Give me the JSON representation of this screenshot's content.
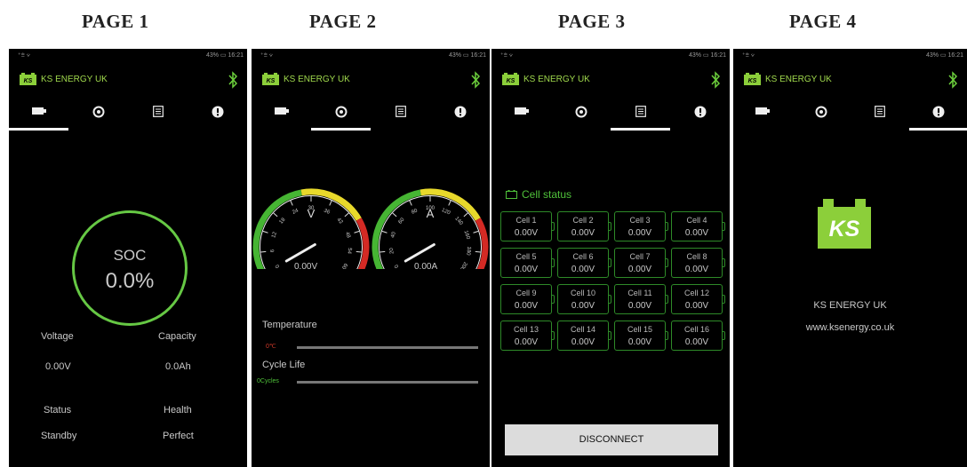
{
  "page_labels": [
    "PAGE 1",
    "PAGE 2",
    "PAGE 3",
    "PAGE 4"
  ],
  "status_bar": {
    "left": "⁺⩧ ⩒",
    "right": "43% ▭ 16:21"
  },
  "app": {
    "title": "KS ENERGY UK",
    "accent": "#66c844",
    "logo_text": "KS"
  },
  "tabs": [
    {
      "name": "battery",
      "icon": "battery-icon"
    },
    {
      "name": "gauges",
      "icon": "gauge-icon"
    },
    {
      "name": "cells",
      "icon": "list-icon"
    },
    {
      "name": "info",
      "icon": "info-icon"
    }
  ],
  "page1": {
    "soc_label": "SOC",
    "soc_value": "0.0%",
    "voltage_label": "Voltage",
    "voltage_value": "0.00V",
    "capacity_label": "Capacity",
    "capacity_value": "0.0Ah",
    "status_label": "Status",
    "status_value": "Standby",
    "health_label": "Health",
    "health_value": "Perfect"
  },
  "page2": {
    "voltage_gauge": {
      "unit": "V",
      "value": "0.00V",
      "ticks": [
        "0",
        "6",
        "12",
        "18",
        "24",
        "30",
        "36",
        "42",
        "48",
        "54",
        "60"
      ]
    },
    "current_gauge": {
      "unit": "A",
      "value": "0.00A",
      "ticks": [
        "0",
        "20",
        "40",
        "60",
        "80",
        "100",
        "120",
        "140",
        "160",
        "180",
        "200"
      ]
    },
    "temperature_label": "Temperature",
    "temperature_value": "0℃",
    "cycle_label": "Cycle Life",
    "cycle_value": "0Cycles"
  },
  "page3": {
    "header": "Cell status",
    "cells": [
      {
        "name": "Cell 1",
        "value": "0.00V"
      },
      {
        "name": "Cell 2",
        "value": "0.00V"
      },
      {
        "name": "Cell 3",
        "value": "0.00V"
      },
      {
        "name": "Cell 4",
        "value": "0.00V"
      },
      {
        "name": "Cell 5",
        "value": "0.00V"
      },
      {
        "name": "Cell 6",
        "value": "0.00V"
      },
      {
        "name": "Cell 7",
        "value": "0.00V"
      },
      {
        "name": "Cell 8",
        "value": "0.00V"
      },
      {
        "name": "Cell 9",
        "value": "0.00V"
      },
      {
        "name": "Cell 10",
        "value": "0.00V"
      },
      {
        "name": "Cell 11",
        "value": "0.00V"
      },
      {
        "name": "Cell 12",
        "value": "0.00V"
      },
      {
        "name": "Cell 13",
        "value": "0.00V"
      },
      {
        "name": "Cell 14",
        "value": "0.00V"
      },
      {
        "name": "Cell 15",
        "value": "0.00V"
      },
      {
        "name": "Cell 16",
        "value": "0.00V"
      }
    ],
    "disconnect_label": "DISCONNECT"
  },
  "page4": {
    "company": "KS ENERGY UK",
    "website": "www.ksenergy.co.uk"
  }
}
